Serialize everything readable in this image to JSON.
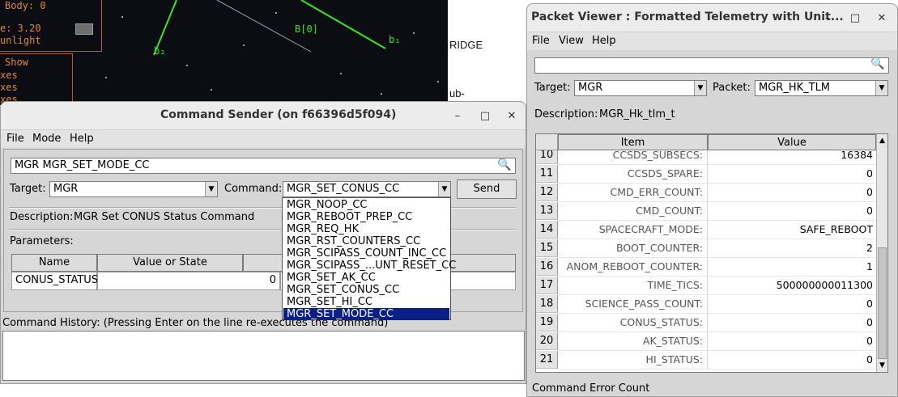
{
  "background": {
    "hud_lines": [
      "Body: 0",
      "e:  3.20",
      "unlight"
    ],
    "hud_lines2": [
      "Show",
      "xes",
      "xes",
      "xes"
    ],
    "label_b": "B[0]",
    "label_b2": "b₂",
    "label_b1": "b₁",
    "doc_text_1": "RIDGE",
    "doc_text_2": "ub-"
  },
  "command_sender": {
    "title": "Command Sender (on f66396d5f094)",
    "menu": [
      "File",
      "Mode",
      "Help"
    ],
    "search_value": "MGR MGR_SET_MODE_CC",
    "target_label": "Target:",
    "target_value": "MGR",
    "command_label": "Command:",
    "command_value": "MGR_SET_CONUS_CC",
    "send_label": "Send",
    "description_label": "Description:",
    "description_value": "MGR Set CONUS Status Command",
    "parameters_label": "Parameters:",
    "param_columns": [
      "Name",
      "Value or State"
    ],
    "params": [
      {
        "name": "CONUS_STATUS:",
        "value": "0"
      }
    ],
    "history_label": "Command History: (Pressing Enter on the line re-executes the command)",
    "dropdown_options": [
      "MGR_NOOP_CC",
      "MGR_REBOOT_PREP_CC",
      "MGR_REQ_HK",
      "MGR_RST_COUNTERS_CC",
      "MGR_SCIPASS_COUNT_INC_CC",
      "MGR_SCIPASS_...UNT_RESET_CC",
      "MGR_SET_AK_CC",
      "MGR_SET_CONUS_CC",
      "MGR_SET_HI_CC",
      "MGR_SET_MODE_CC"
    ],
    "dropdown_selected_index": 9
  },
  "packet_viewer": {
    "title": "Packet Viewer : Formatted Telemetry with Unit...",
    "menu": [
      "File",
      "View",
      "Help"
    ],
    "search_value": "",
    "target_label": "Target:",
    "target_value": "MGR",
    "packet_label": "Packet:",
    "packet_value": "MGR_HK_TLM",
    "description_label": "Description:",
    "description_value": "MGR_Hk_tlm_t",
    "columns": [
      "Item",
      "Value"
    ],
    "rows": [
      {
        "num": "10",
        "item": "CCSDS_SUBSECS:",
        "value": "16384"
      },
      {
        "num": "11",
        "item": "CCSDS_SPARE:",
        "value": "0"
      },
      {
        "num": "12",
        "item": "CMD_ERR_COUNT:",
        "value": "0"
      },
      {
        "num": "13",
        "item": "CMD_COUNT:",
        "value": "0"
      },
      {
        "num": "14",
        "item": "SPACECRAFT_MODE:",
        "value": "SAFE_REBOOT"
      },
      {
        "num": "15",
        "item": "BOOT_COUNTER:",
        "value": "2"
      },
      {
        "num": "16",
        "item": "ANOM_REBOOT_COUNTER:",
        "value": "1"
      },
      {
        "num": "17",
        "item": "TIME_TICS:",
        "value": "500000000011300"
      },
      {
        "num": "18",
        "item": "SCIENCE_PASS_COUNT:",
        "value": "0"
      },
      {
        "num": "19",
        "item": "CONUS_STATUS:",
        "value": "0"
      },
      {
        "num": "20",
        "item": "AK_STATUS:",
        "value": "0"
      },
      {
        "num": "21",
        "item": "HI_STATUS:",
        "value": "0"
      }
    ],
    "status_text": "Command Error Count"
  },
  "icons": {
    "search": "search-icon",
    "minimize": "minimize-icon",
    "maximize": "maximize-icon",
    "close": "close-icon"
  },
  "colors": {
    "selection": "#0a1f87",
    "hud": "#e08a2a",
    "vector": "#39e61c"
  }
}
